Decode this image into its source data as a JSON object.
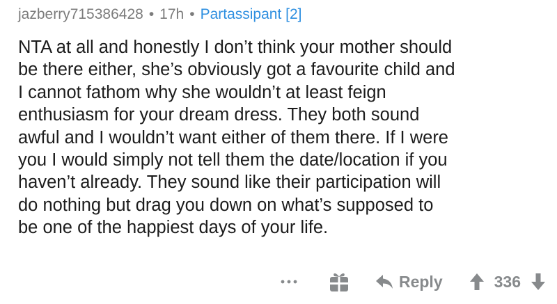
{
  "comment": {
    "username": "jazberry715386428",
    "separator": "•",
    "age": "17h",
    "flair": "Partassipant [2]",
    "body_lines": [
      "NTA at all and honestly I don’t think your mother should",
      "be there either, she’s obviously got a favourite child and",
      "I cannot fathom why she wouldn’t at least feign",
      "enthusiasm for your dream dress. They both sound",
      "awful and I wouldn’t want either of them there. If I were",
      "you I would simply not tell them the date/location if you",
      "haven’t already. They sound like their participation will",
      "do nothing but drag you down on what’s supposed to",
      "be one of the happiest days of your life."
    ]
  },
  "actions": {
    "more_icon": "more-options-icon",
    "gift_icon": "gift-icon",
    "reply_icon": "reply-arrow-icon",
    "reply_label": "Reply",
    "upvote_icon": "upvote-arrow-icon",
    "score": "336",
    "downvote_icon": "downvote-arrow-icon"
  },
  "colors": {
    "meta_gray": "#7c7c7c",
    "flair_blue": "#2e8fe0",
    "text": "#1c1c1c",
    "action_gray": "#878a8c"
  }
}
